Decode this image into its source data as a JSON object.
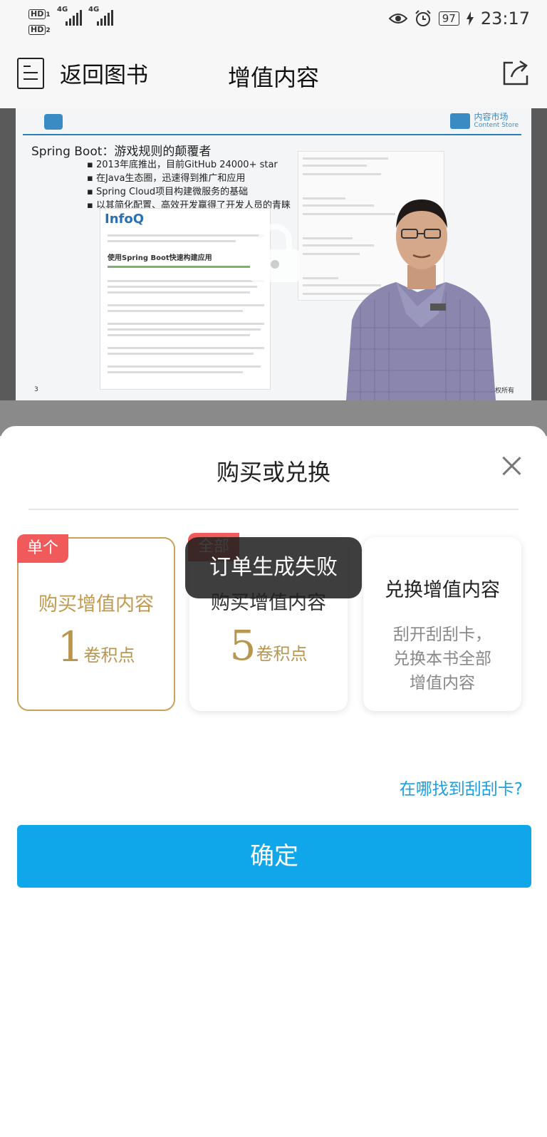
{
  "status_bar": {
    "hd1": "HD",
    "hd1_sub": "1",
    "hd2": "HD",
    "hd2_sub": "2",
    "net1": "4G",
    "net2": "4G",
    "battery": "97",
    "time": "23:17"
  },
  "header": {
    "back_label": "返回图书",
    "title": "增值内容"
  },
  "video": {
    "slide_title": "Spring Boot：游戏规则的颠覆者",
    "bullets": [
      "2013年底推出，目前GitHub 24000+ star",
      "在Java生态圈，迅速得到推广和应用",
      "Spring Cloud项目构建微服务的基础",
      "以其简化配置、高效开发赢得了开发人员的青睐"
    ],
    "doc_logo": "InfoQ",
    "doc_heading": "使用Spring Boot快速构建应用",
    "store_label": "内容市场",
    "store_label_en": "Content Store",
    "page_number": "3",
    "copyright": "公司 版权所有"
  },
  "sheet": {
    "title": "购买或兑换",
    "cards": [
      {
        "tag": "单个",
        "title": "购买增值内容",
        "price": "1",
        "unit": "卷积点"
      },
      {
        "tag": "全部",
        "title": "购买增值内容",
        "price": "5",
        "unit": "卷积点"
      },
      {
        "title": "兑换增值内容",
        "desc_lines": [
          "刮开刮刮卡，",
          "兑换本书全部",
          "增值内容"
        ]
      }
    ],
    "toast": "订单生成失败",
    "help_link": "在哪找到刮刮卡?",
    "confirm_label": "确定"
  },
  "colors": {
    "accent": "#0fa6ea",
    "gold": "#c29a4f",
    "tag_red": "#f05a5a"
  }
}
